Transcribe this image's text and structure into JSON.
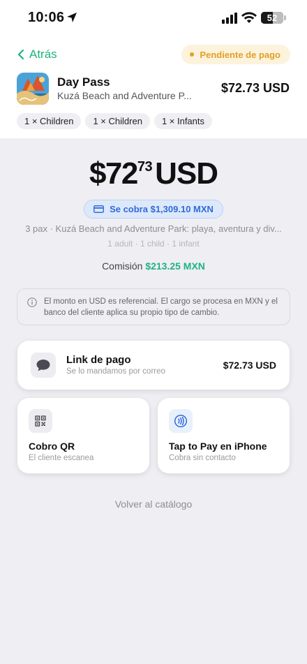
{
  "status_bar": {
    "time": "10:06",
    "battery": "52",
    "battery_level": 0.52
  },
  "header": {
    "back_label": "Atrás",
    "status_badge": "Pendiente de pago"
  },
  "product": {
    "title": "Day Pass",
    "subtitle": "Kuzá Beach and Adventure P...",
    "price": "$72.73 USD",
    "chips": [
      "1 × Children",
      "1 × Children",
      "1 × Infants"
    ]
  },
  "amount": {
    "whole": "$72",
    "cents": "73",
    "currency": "USD"
  },
  "charge_badge": "Se cobra $1,309.10 MXN",
  "description": "3 pax · Kuzá Beach and Adventure Park: playa, aventura y div...",
  "pax_breakdown": "1 adult · 1 child · 1 infant",
  "commission": {
    "label": "Comisión",
    "value": "$213.25 MXN"
  },
  "info_note": "El monto en USD es referencial. El cargo se procesa en MXN y el banco del cliente aplica su propio tipo de cambio.",
  "payment_options": {
    "link": {
      "title": "Link de pago",
      "subtitle": "Se lo mandamos por correo",
      "price": "$72.73 USD",
      "icon": "chat-bubble-icon"
    },
    "qr": {
      "title": "Cobro QR",
      "subtitle": "El cliente escanea",
      "icon": "qr-code-icon"
    },
    "tap": {
      "title": "Tap to Pay en iPhone",
      "subtitle": "Cobra sin contacto",
      "icon": "contactless-icon"
    }
  },
  "return_link": "Volver al catálogo",
  "colors": {
    "accent": "#1fb37c",
    "pending": "#e0a02a",
    "charge_blue": "#2f6bd8",
    "background": "#eeeef3"
  }
}
